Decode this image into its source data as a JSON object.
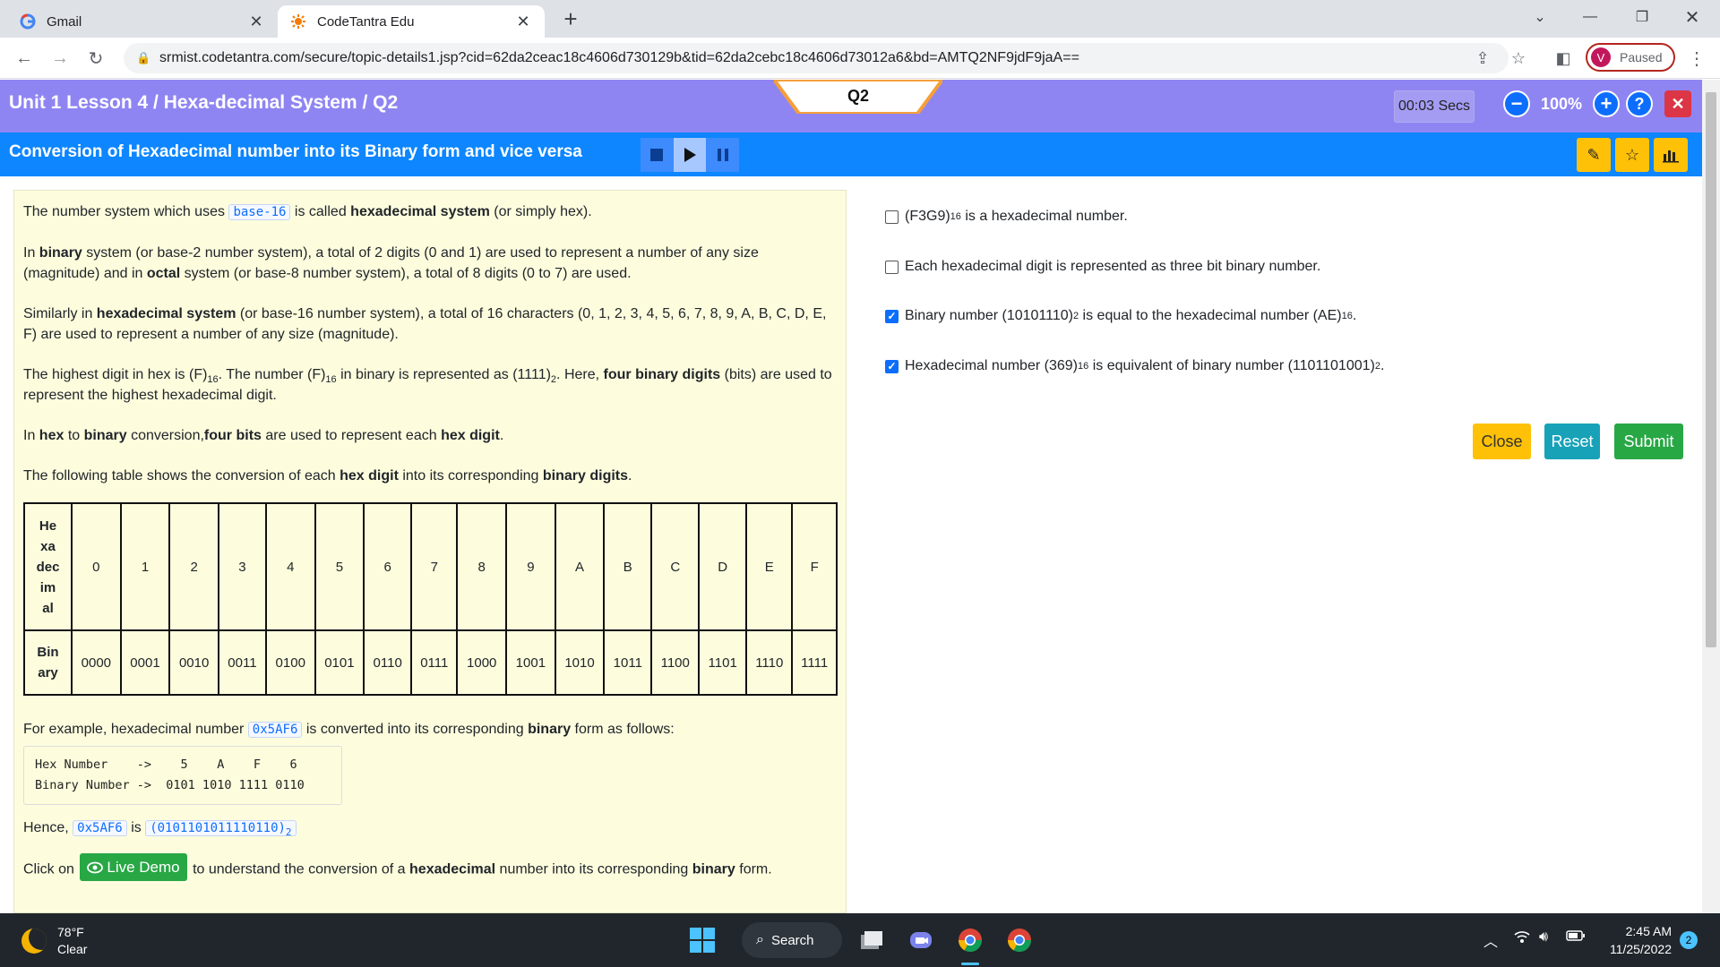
{
  "browser": {
    "tabs": [
      {
        "title": "Gmail",
        "icon": "google-icon"
      },
      {
        "title": "CodeTantra Edu",
        "icon": "codetantra-icon"
      }
    ],
    "url": "srmist.codetantra.com/secure/topic-details1.jsp?cid=62da2ceac18c4606d730129b&tid=62da2cebc18c4606d73012a6&bd=AMTQ2NF9jdF9jaA==",
    "profile_initial": "V",
    "profile_status": "Paused"
  },
  "header": {
    "lesson": "Unit 1 Lesson 4 / Hexa-decimal System / Q2",
    "question_tab": "Q2",
    "timer": "00:03 Secs",
    "zoom": "100%",
    "subtitle": "Conversion of Hexadecimal number into its Binary form and vice versa"
  },
  "content": {
    "p1_a": "The number system which uses",
    "p1_code": "base-16",
    "p1_b": "is called",
    "p1_bold": "hexadecimal system",
    "p1_c": "(or simply hex).",
    "p2_a": "In",
    "p2_b1": "binary",
    "p2_b": "system (or base-2 number system), a total of 2 digits (0 and 1) are used to represent a number of any size (magnitude) and in",
    "p2_b2": "octal",
    "p2_c": "system (or base-8 number system), a total of 8 digits (0 to 7) are used.",
    "p3_a": "Similarly in",
    "p3_b1": "hexadecimal system",
    "p3_b": "(or base-16 number system), a total of 16 characters (0, 1, 2, 3, 4, 5, 6, 7, 8, 9, A, B, C, D, E, F) are used to represent a number of any size (magnitude).",
    "p4_a": "The highest digit in hex is (F)",
    "p4_sub1": "16",
    "p4_b": ". The number (F)",
    "p4_sub2": "16",
    "p4_c": "in binary is represented as (1111)",
    "p4_sub3": "2",
    "p4_d": ". Here,",
    "p4_b1": "four binary digits",
    "p4_e": "(bits) are used to represent the highest hexadecimal digit.",
    "p5_a": "In",
    "p5_b1": "hex",
    "p5_b": "to",
    "p5_b2": "binary",
    "p5_c": "conversion,",
    "p5_b3": "four bits",
    "p5_d": "are used to represent each",
    "p5_b4": "hex digit",
    "p5_e": ".",
    "p6_a": "The following table shows the conversion of each",
    "p6_b1": "hex digit",
    "p6_b": "into its corresponding",
    "p6_b2": "binary digits",
    "p6_c": ".",
    "table": {
      "row1_header": [
        "He",
        "xa",
        "dec",
        "im",
        "al"
      ],
      "row2_header": [
        "Bin",
        "ary"
      ],
      "hex": [
        "0",
        "1",
        "2",
        "3",
        "4",
        "5",
        "6",
        "7",
        "8",
        "9",
        "A",
        "B",
        "C",
        "D",
        "E",
        "F"
      ],
      "binary": [
        "0000",
        "0001",
        "0010",
        "0011",
        "0100",
        "0101",
        "0110",
        "0111",
        "1000",
        "1001",
        "1010",
        "1011",
        "1100",
        "1101",
        "1110",
        "1111"
      ]
    },
    "p7_a": "For example, hexadecimal number",
    "p7_code": "0x5AF6",
    "p7_b": "is converted into its corresponding",
    "p7_b1": "binary",
    "p7_c": "form as follows:",
    "code_line1": "Hex Number    ->    5    A    F    6",
    "code_line2": "Binary Number ->  0101 1010 1111 0110",
    "p8_a": "Hence,",
    "p8_code1": "0x5AF6",
    "p8_b": "is",
    "p8_code2": "(0101101011110110)",
    "p8_sub": "2",
    "p9_a": "Click on",
    "p9_btn": "Live Demo",
    "p9_b": "to understand the conversion of a",
    "p9_b1": "hexadecimal",
    "p9_c": "number into its corresponding",
    "p9_b2": "binary",
    "p9_d": "form."
  },
  "options": [
    {
      "a": "(F3G9)",
      "sub1": "16",
      "b": "is a hexadecimal number.",
      "checked": false
    },
    {
      "a": "Each hexadecimal digit is represented as three bit binary number.",
      "checked": false
    },
    {
      "a": "Binary number (10101110)",
      "sub1": "2",
      "b": "is equal to the hexadecimal number (AE)",
      "sub2": "16",
      "c": ".",
      "checked": true
    },
    {
      "a": "Hexadecimal number (369)",
      "sub1": "16",
      "b": "is equivalent of binary number (1101101001)",
      "sub2": "2",
      "c": ".",
      "checked": true
    }
  ],
  "actions": {
    "close": "Close",
    "reset": "Reset",
    "submit": "Submit"
  },
  "colors": {
    "header_purple": "#8f85f2",
    "header_blue": "#0d86ff",
    "close_yellow": "#ffc107",
    "reset_teal": "#17a2b8",
    "submit_green": "#28a745"
  },
  "taskbar": {
    "temp": "78°F",
    "cond": "Clear",
    "search": "Search",
    "time": "2:45 AM",
    "date": "11/25/2022",
    "notifications": "2"
  }
}
